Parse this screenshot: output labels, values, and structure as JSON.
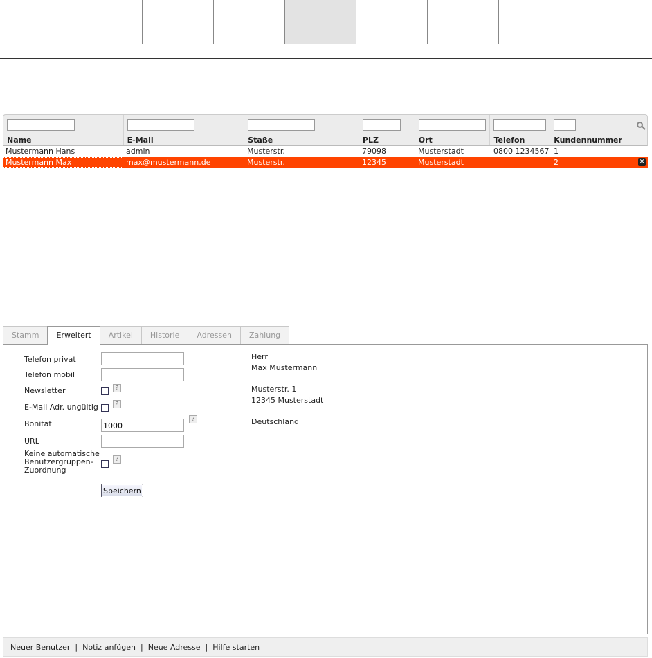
{
  "grid": {
    "columns": [
      {
        "label": "Name",
        "width": 174,
        "filter_width": 98
      },
      {
        "label": "E-Mail",
        "width": 175,
        "filter_width": 97
      },
      {
        "label": "Staße",
        "width": 166,
        "filter_width": 97
      },
      {
        "label": "PLZ",
        "width": 81,
        "filter_width": 55
      },
      {
        "label": "Ort",
        "width": 109,
        "filter_width": 97
      },
      {
        "label": "Telefon",
        "width": 87,
        "filter_width": 76
      },
      {
        "label": "Kundennummer",
        "width": 140,
        "filter_width": 32
      }
    ],
    "rows": [
      {
        "name": "Mustermann Hans",
        "email": "admin",
        "street": "Musterstr.",
        "plz": "79098",
        "ort": "Musterstadt",
        "telefon": "0800 1234567",
        "kundennummer": "1",
        "selected": false
      },
      {
        "name": "Mustermann Max",
        "email": "max@mustermann.de",
        "street": "Musterstr.",
        "plz": "12345",
        "ort": "Musterstadt",
        "telefon": "",
        "kundennummer": "2",
        "selected": true
      }
    ]
  },
  "tabs": [
    "Stamm",
    "Erweitert",
    "Artikel",
    "Historie",
    "Adressen",
    "Zahlung"
  ],
  "active_tab": "Erweitert",
  "form": {
    "telefon_privat_label": "Telefon privat",
    "telefon_privat_value": "",
    "telefon_mobil_label": "Telefon mobil",
    "telefon_mobil_value": "",
    "newsletter_label": "Newsletter",
    "email_invalid_label": "E-Mail Adr. ungültig",
    "bonitat_label": "Bonitat",
    "bonitat_value": "1000",
    "url_label": "URL",
    "url_value": "",
    "keine_line1": "Keine automatische",
    "keine_line2": "Benutzergruppen-",
    "keine_line3": "Zuordnung",
    "save_label": "Speichern",
    "help_glyph": "?"
  },
  "address": {
    "salutation": "Herr",
    "name": "Max Mustermann",
    "street": "Musterstr. 1",
    "city": "12345 Musterstadt",
    "country": "Deutschland"
  },
  "footer": {
    "links": [
      "Neuer Benutzer",
      "Notiz anfügen",
      "Neue Adresse",
      "Hilfe starten"
    ],
    "separator": "|"
  },
  "colors": {
    "selected_row": "#ff4400",
    "active_nav": "#e3e3e3"
  }
}
